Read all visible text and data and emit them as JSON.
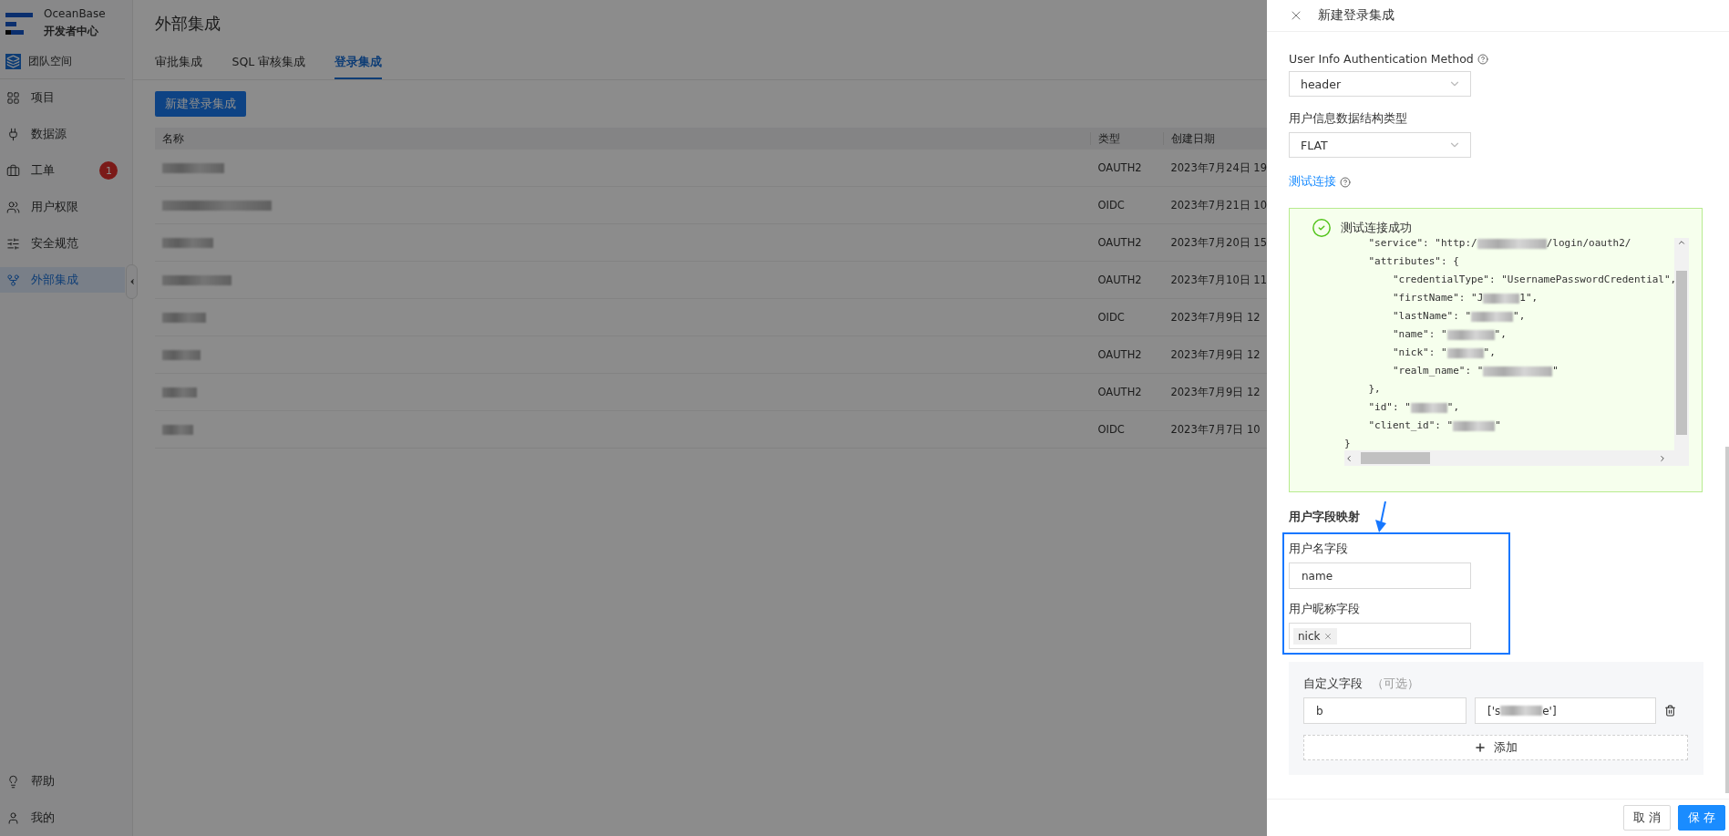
{
  "app": {
    "brand": "OceanBase",
    "subtitle": "开发者中心"
  },
  "sidebar": {
    "team": "团队空间",
    "items": [
      {
        "label": "项目",
        "selected": false
      },
      {
        "label": "数据源",
        "selected": false
      },
      {
        "label": "工单",
        "selected": false,
        "badge": "1"
      },
      {
        "label": "用户权限",
        "selected": false
      },
      {
        "label": "安全规范",
        "selected": false
      },
      {
        "label": "外部集成",
        "selected": true
      }
    ],
    "bottom": [
      {
        "label": "帮助"
      },
      {
        "label": "我的"
      }
    ]
  },
  "page": {
    "title": "外部集成",
    "tabs": [
      {
        "label": "审批集成",
        "selected": false
      },
      {
        "label": "SQL 审核集成",
        "selected": false
      },
      {
        "label": "登录集成",
        "selected": true
      }
    ],
    "new_button": "新建登录集成",
    "table": {
      "columns": [
        "名称",
        "类型",
        "创建日期"
      ],
      "rows": [
        {
          "name_blurred": true,
          "type": "OAUTH2",
          "created": "2023年7月24日 19"
        },
        {
          "name_blurred": true,
          "type": "OIDC",
          "created": "2023年7月21日 10"
        },
        {
          "name_blurred": true,
          "type": "OAUTH2",
          "created": "2023年7月20日 15"
        },
        {
          "name_blurred": true,
          "type": "OAUTH2",
          "created": "2023年7月10日 11"
        },
        {
          "name_blurred": true,
          "type": "OIDC",
          "created": "2023年7月9日 12"
        },
        {
          "name_blurred": true,
          "type": "OAUTH2",
          "created": "2023年7月9日 12"
        },
        {
          "name_blurred": true,
          "type": "OAUTH2",
          "created": "2023年7月9日 12"
        },
        {
          "name_blurred": true,
          "type": "OIDC",
          "created": "2023年7月7日 10"
        }
      ]
    }
  },
  "drawer": {
    "title": "新建登录集成",
    "fields": [
      {
        "label": "User Info Authentication Method",
        "help": true,
        "value": "header"
      },
      {
        "label": "用户信息数据结构类型",
        "help": false,
        "value": "FLAT"
      }
    ],
    "test_link": "测试连接",
    "result": {
      "title": "测试连接成功",
      "lines": [
        [
          {
            "kind": "text",
            "text": "    \"service\": \"http:/"
          },
          {
            "kind": "blur-long"
          },
          {
            "kind": "text",
            "text": "/login/oauth2/"
          }
        ],
        [
          {
            "kind": "text",
            "text": "    \"attributes\": {"
          }
        ],
        [
          {
            "kind": "text",
            "text": "        \"credentialType\": \"UsernamePasswordCredential\","
          }
        ],
        [
          {
            "kind": "text",
            "text": "        \"firstName\": \"J"
          },
          {
            "kind": "blur"
          },
          {
            "kind": "text",
            "text": "1\","
          }
        ],
        [
          {
            "kind": "text",
            "text": "        \"lastName\": \""
          },
          {
            "kind": "blur"
          },
          {
            "kind": "text",
            "text": "\","
          }
        ],
        [
          {
            "kind": "text",
            "text": "        \"name\": \""
          },
          {
            "kind": "blur"
          },
          {
            "kind": "text",
            "text": "\","
          }
        ],
        [
          {
            "kind": "text",
            "text": "        \"nick\": \""
          },
          {
            "kind": "blur"
          },
          {
            "kind": "text",
            "text": "\","
          }
        ],
        [
          {
            "kind": "text",
            "text": "        \"realm_name\": \""
          },
          {
            "kind": "blur-long"
          },
          {
            "kind": "text",
            "text": "\""
          }
        ],
        [
          {
            "kind": "text",
            "text": "    },"
          }
        ],
        [
          {
            "kind": "text",
            "text": "    \"id\": \""
          },
          {
            "kind": "blur"
          },
          {
            "kind": "text",
            "text": "\","
          }
        ],
        [
          {
            "kind": "text",
            "text": "    \"client_id\": \""
          },
          {
            "kind": "blur"
          },
          {
            "kind": "text",
            "text": "\""
          }
        ],
        [
          {
            "kind": "text",
            "text": "}"
          }
        ]
      ]
    },
    "mapping": {
      "title": "用户字段映射",
      "username": {
        "label": "用户名字段",
        "value": "name"
      },
      "nickname": {
        "label": "用户昵称字段",
        "tags": [
          "nick"
        ]
      }
    },
    "custom": {
      "label": "自定义字段",
      "optional": "（可选）",
      "rows": [
        {
          "key": "b",
          "value": [
            {
              "kind": "text",
              "text": "['s"
            },
            {
              "kind": "blur"
            },
            {
              "kind": "text",
              "text": "e']"
            }
          ]
        }
      ],
      "add": "添加"
    },
    "buttons": {
      "cancel": "取 消",
      "save": "保 存"
    }
  }
}
